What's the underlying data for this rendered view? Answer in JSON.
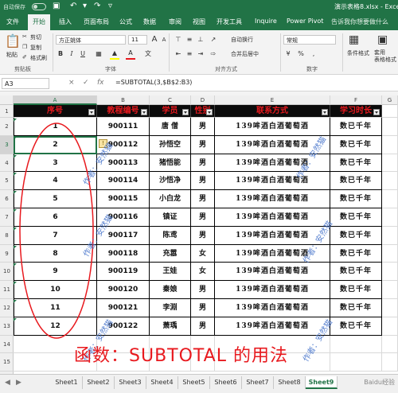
{
  "titlebar": {
    "autosave_label": "自动保存",
    "autosave_state": "关",
    "doc_title": "演示表格8.xlsx - Excel"
  },
  "tabs": [
    "文件",
    "开始",
    "插入",
    "页面布局",
    "公式",
    "数据",
    "审阅",
    "视图",
    "开发工具",
    "Inquire",
    "Power Pivot"
  ],
  "active_tab": "开始",
  "tell_me": "告诉我你想要做什么",
  "ribbon": {
    "clipboard": {
      "label": "剪贴板",
      "paste": "粘贴",
      "cut": "剪切",
      "copy": "复制",
      "format_painter": "格式刷"
    },
    "font": {
      "label": "字体",
      "name": "方正姚体",
      "size": "11",
      "grow": "A",
      "shrink": "A",
      "bold": "B",
      "italic": "I",
      "underline": "U",
      "wen": "文"
    },
    "alignment": {
      "label": "对齐方式",
      "wrap": "自动换行",
      "merge": "合并后居中"
    },
    "number": {
      "label": "数字",
      "format": "常规"
    },
    "styles": {
      "conditional": "条件格式",
      "table": "套用\n表格格式"
    },
    "font_color": "#e8191e",
    "fill_color": "#ffff00"
  },
  "formula_bar": {
    "name_box": "A3",
    "formula": "=SUBTOTAL(3,$B$2:B3)",
    "fx": "fx",
    "cancel": "×",
    "enter": "✓"
  },
  "columns": [
    "A",
    "B",
    "C",
    "D",
    "E",
    "F",
    "G"
  ],
  "rows": [
    "1",
    "2",
    "3",
    "4",
    "5",
    "6",
    "7",
    "8",
    "9",
    "10",
    "11",
    "12",
    "13",
    "14",
    "15"
  ],
  "table": {
    "headers": [
      "序号",
      "教程编号",
      "学员",
      "性别",
      "联系方式",
      "学习时长"
    ],
    "rows": [
      [
        "1",
        "900111",
        "唐 僧",
        "男",
        "139哞酒白酒葡萄酒",
        "数已千年"
      ],
      [
        "2",
        "900112",
        "孙悟空",
        "男",
        "139哞酒白酒葡萄酒",
        "数已千年"
      ],
      [
        "3",
        "900113",
        "猪悟能",
        "男",
        "139哞酒白酒葡萄酒",
        "数已千年"
      ],
      [
        "4",
        "900114",
        "沙悟净",
        "男",
        "139哞酒白酒葡萄酒",
        "数已千年"
      ],
      [
        "5",
        "900115",
        "小白龙",
        "男",
        "139哞酒白酒葡萄酒",
        "数已千年"
      ],
      [
        "6",
        "900116",
        "镇证",
        "男",
        "139哞酒白酒葡萄酒",
        "数已千年"
      ],
      [
        "7",
        "900117",
        "陈鸢",
        "男",
        "139哞酒白酒葡萄酒",
        "数已千年"
      ],
      [
        "8",
        "900118",
        "充嚣",
        "女",
        "139哞酒白酒葡萄酒",
        "数已千年"
      ],
      [
        "9",
        "900119",
        "王娃",
        "女",
        "139哞酒白酒葡萄酒",
        "数已千年"
      ],
      [
        "10",
        "900120",
        "秦娘",
        "男",
        "139哞酒白酒葡萄酒",
        "数已千年"
      ],
      [
        "11",
        "900121",
        "李淵",
        "男",
        "139哞酒白酒葡萄酒",
        "数已千年"
      ],
      [
        "12",
        "900122",
        "萧瑀",
        "男",
        "139哞酒白酒葡萄酒",
        "数已千年"
      ]
    ]
  },
  "caption": "函数：SUBTOTAL 的用法",
  "watermark": "作者：安然猫",
  "warning_icon": "!",
  "sheets": [
    "Sheet1",
    "Sheet2",
    "Sheet3",
    "Sheet4",
    "Sheet5",
    "Sheet6",
    "Sheet7",
    "Sheet8",
    "Sheet9"
  ],
  "active_sheet": "Sheet9",
  "brand": "Baidu经验"
}
